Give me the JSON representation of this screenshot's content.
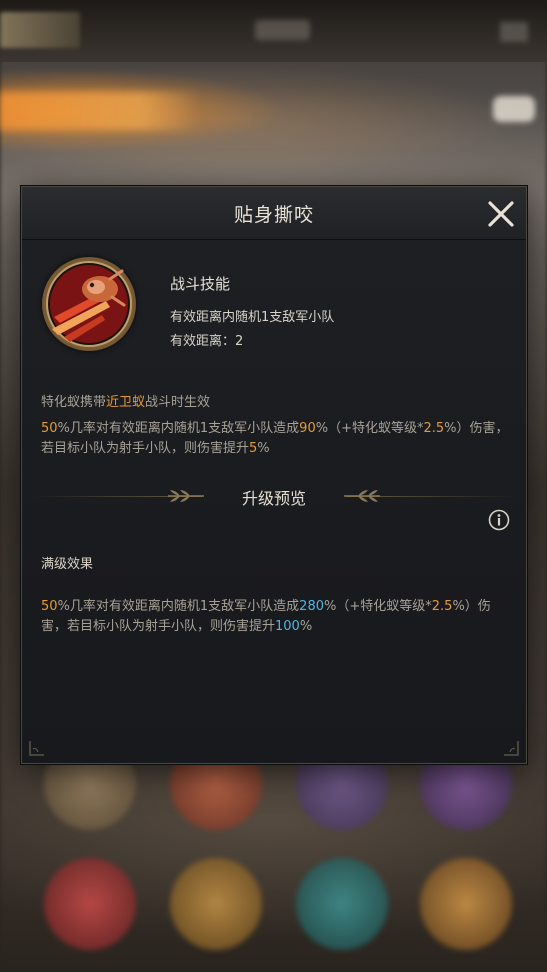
{
  "background": {
    "accent_color": "#f19235"
  },
  "dialog": {
    "title": "贴身撕咬",
    "close_icon": "close-icon",
    "skill": {
      "icon": "ant-skill-icon",
      "type_label": "战斗技能",
      "description": "有效距离内随机1支敌军小队",
      "range_label": "有效距离：",
      "range_value": "2"
    },
    "condition": {
      "prefix": "特化蚁携带",
      "unit": "近卫蚁",
      "suffix": "战斗时生效"
    },
    "effect": {
      "chance": "50",
      "t1": "%几率对有效距离内随机1支敌军小队造成",
      "damage": "90",
      "t2": "%（+特化蚁等级*",
      "per_level": "2.5",
      "t3": "%）伤害，若目标小队为射手小队，则伤害提升",
      "bonus": "5",
      "t4": "%"
    },
    "upgrade_preview": {
      "title": "升级预览",
      "info_icon": "info-icon"
    },
    "max_level": {
      "label": "满级效果",
      "chance": "50",
      "t1": "%几率对有效距离内随机1支敌军小队造成",
      "damage": "280",
      "t2": "%（+特化蚁等级*",
      "per_level": "2.5",
      "t3": "%）伤害，若目标小队为射手小队，则伤害提升",
      "bonus": "100",
      "t4": "%"
    },
    "colors": {
      "highlight_orange": "#e49a3a",
      "highlight_blue": "#52b5e6",
      "text_muted": "#a7a296"
    }
  }
}
